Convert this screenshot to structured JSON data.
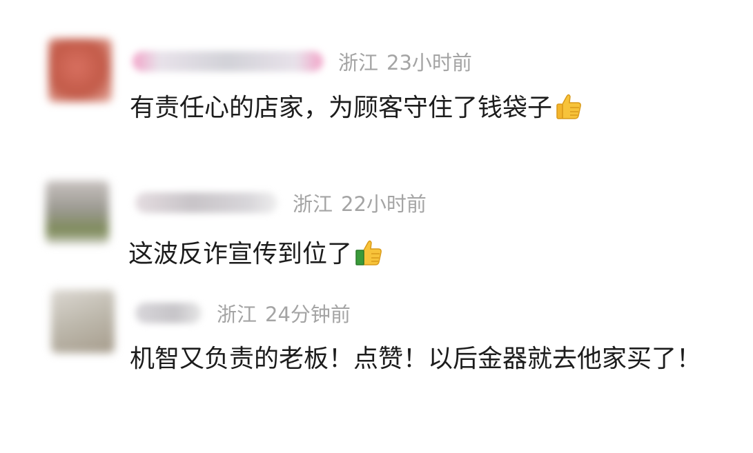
{
  "comments": [
    {
      "location": "浙江",
      "time": "23小时前",
      "text": "有责任心的店家，为顾客守住了钱袋子",
      "emoji": "thumbs-up"
    },
    {
      "location": "浙江",
      "time": "22小时前",
      "text": "这波反诈宣传到位了",
      "emoji": "thumbs-up"
    },
    {
      "location": "浙江",
      "time": "24分钟前",
      "text": "机智又负责的老板！点赞！以后金器就去他家买了！",
      "emoji": ""
    }
  ],
  "colors": {
    "meta_text": "#a4a4a4",
    "body_text": "#1c1c1c",
    "thumb_yellow": "#f7c33a"
  }
}
